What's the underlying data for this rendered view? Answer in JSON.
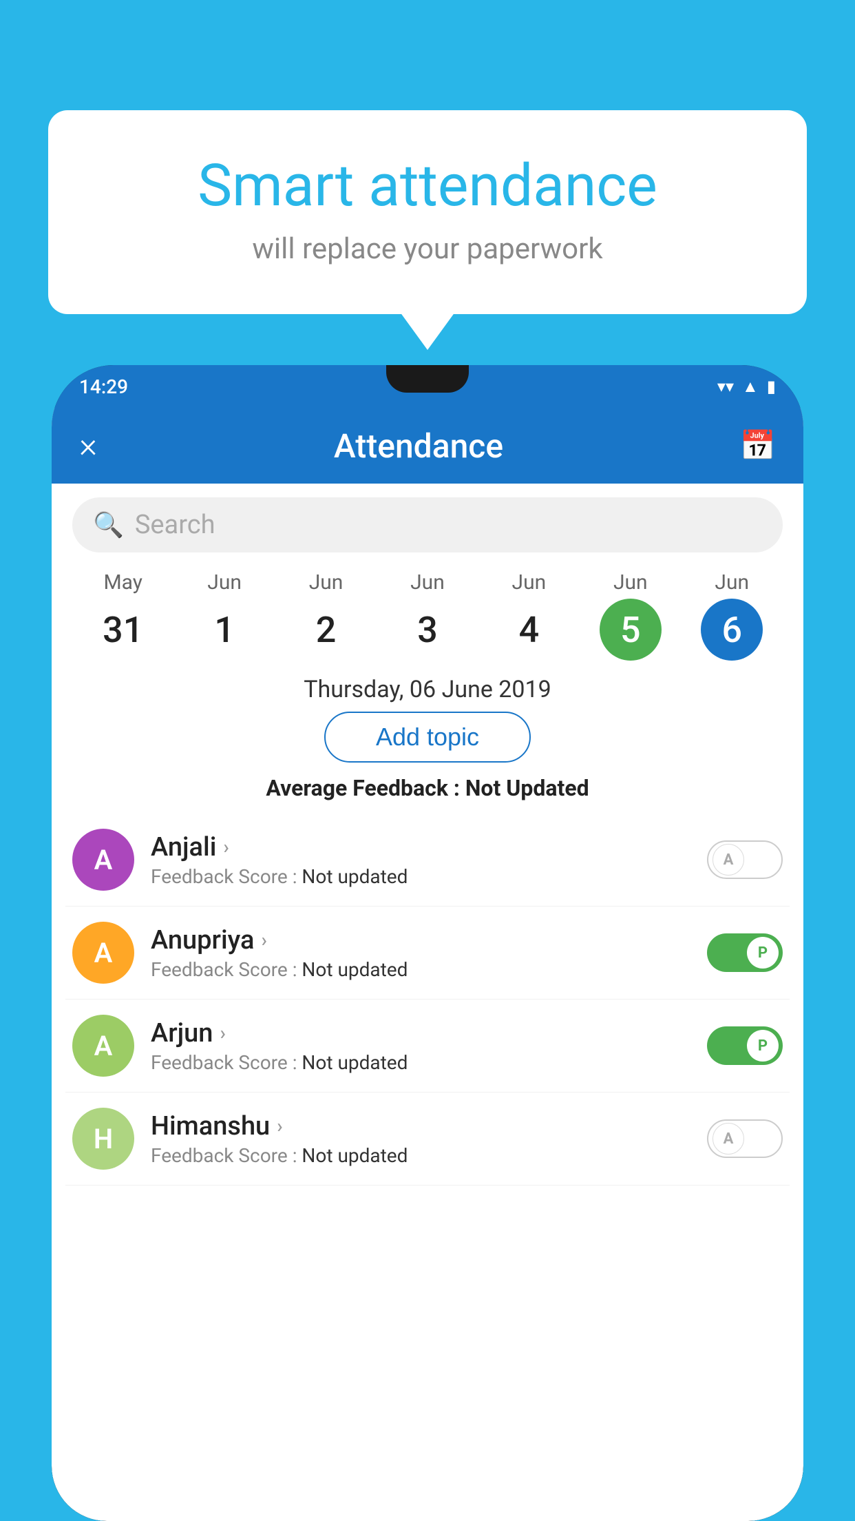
{
  "background_color": "#29b6e8",
  "bubble": {
    "title": "Smart attendance",
    "subtitle": "will replace your paperwork"
  },
  "status_bar": {
    "time": "14:29",
    "icons": [
      "wifi",
      "signal",
      "battery"
    ]
  },
  "header": {
    "title": "Attendance",
    "close_label": "×",
    "calendar_icon": "📅"
  },
  "search": {
    "placeholder": "Search"
  },
  "calendar": {
    "days": [
      {
        "month": "May",
        "num": "31",
        "state": "normal"
      },
      {
        "month": "Jun",
        "num": "1",
        "state": "normal"
      },
      {
        "month": "Jun",
        "num": "2",
        "state": "normal"
      },
      {
        "month": "Jun",
        "num": "3",
        "state": "normal"
      },
      {
        "month": "Jun",
        "num": "4",
        "state": "normal"
      },
      {
        "month": "Jun",
        "num": "5",
        "state": "today"
      },
      {
        "month": "Jun",
        "num": "6",
        "state": "selected"
      }
    ]
  },
  "selected_date": "Thursday, 06 June 2019",
  "add_topic_label": "Add topic",
  "avg_feedback_label": "Average Feedback :",
  "avg_feedback_value": "Not Updated",
  "students": [
    {
      "name": "Anjali",
      "avatar_letter": "A",
      "avatar_color": "#ab47bc",
      "feedback": "Not updated",
      "toggle": "off",
      "toggle_letter": "A"
    },
    {
      "name": "Anupriya",
      "avatar_letter": "A",
      "avatar_color": "#ffa726",
      "feedback": "Not updated",
      "toggle": "on",
      "toggle_letter": "P"
    },
    {
      "name": "Arjun",
      "avatar_letter": "A",
      "avatar_color": "#9ccc65",
      "feedback": "Not updated",
      "toggle": "on",
      "toggle_letter": "P"
    },
    {
      "name": "Himanshu",
      "avatar_letter": "H",
      "avatar_color": "#aed581",
      "feedback": "Not updated",
      "toggle": "off",
      "toggle_letter": "A"
    }
  ],
  "feedback_score_label": "Feedback Score :"
}
